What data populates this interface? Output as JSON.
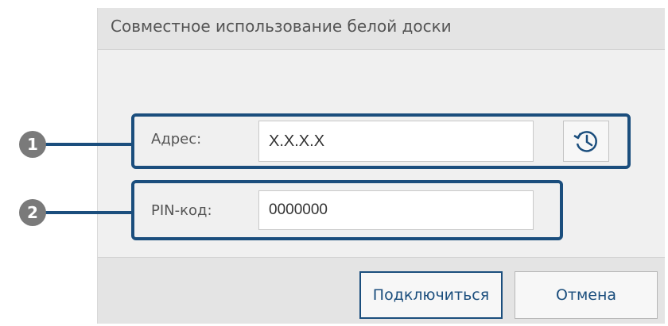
{
  "dialog": {
    "title": "Совместное использование белой доски"
  },
  "fields": {
    "address_label": "Адрес:",
    "address_value": "X.X.X.X",
    "pin_label": "PIN-код:",
    "pin_value": "0000000",
    "history_icon": "history-clock-icon"
  },
  "buttons": {
    "connect": "Подключиться",
    "cancel": "Отмена"
  },
  "callouts": [
    "1",
    "2"
  ],
  "colors": {
    "accent": "#1b4e7d",
    "callout": "#7a7a7a"
  }
}
